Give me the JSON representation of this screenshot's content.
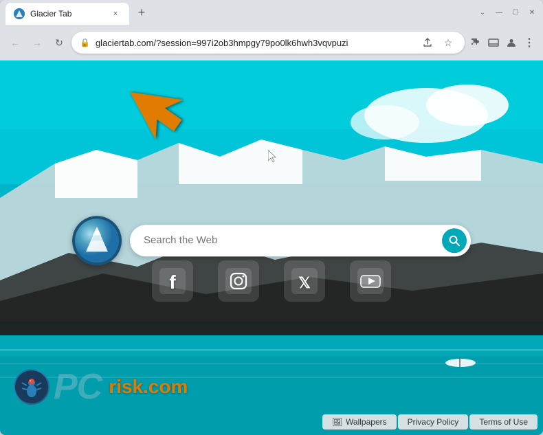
{
  "browser": {
    "tab": {
      "favicon_label": "glacier-favicon",
      "title": "Glacier Tab",
      "close_label": "×"
    },
    "new_tab_label": "+",
    "window_controls": {
      "minimize": "—",
      "maximize": "☐",
      "close": "✕"
    },
    "nav": {
      "back_label": "←",
      "forward_label": "→",
      "reload_label": "↻"
    },
    "address_bar": {
      "lock_icon": "🔒",
      "url": "glaciertab.com/?session=997i2ob3hmpgy79po0lk6hwh3vqvpuzi",
      "share_icon": "⬆",
      "star_icon": "☆",
      "extensions_icon": "🧩",
      "cast_icon": "▭",
      "profile_icon": "👤",
      "menu_icon": "⋮"
    }
  },
  "page": {
    "search_placeholder": "Search the Web",
    "logo_label": "Glacier Tab Logo",
    "social_icons": [
      {
        "name": "facebook",
        "symbol": "f",
        "label": "Facebook"
      },
      {
        "name": "instagram",
        "symbol": "◎",
        "label": "Instagram"
      },
      {
        "name": "twitter",
        "symbol": "𝕏",
        "label": "Twitter/X"
      },
      {
        "name": "youtube",
        "symbol": "▶",
        "label": "YouTube"
      }
    ],
    "bottom_buttons": [
      {
        "name": "wallpapers",
        "label": "Wallpapers",
        "icon": "🖼"
      },
      {
        "name": "privacy-policy",
        "label": "Privacy Policy"
      },
      {
        "name": "terms-of-use",
        "label": "Terms of Use"
      }
    ],
    "watermark": {
      "site_name": "PC",
      "domain": "risk.com"
    }
  },
  "colors": {
    "teal": "#00a8b8",
    "orange": "#e07b00",
    "chrome_bg": "#dee1e6"
  }
}
